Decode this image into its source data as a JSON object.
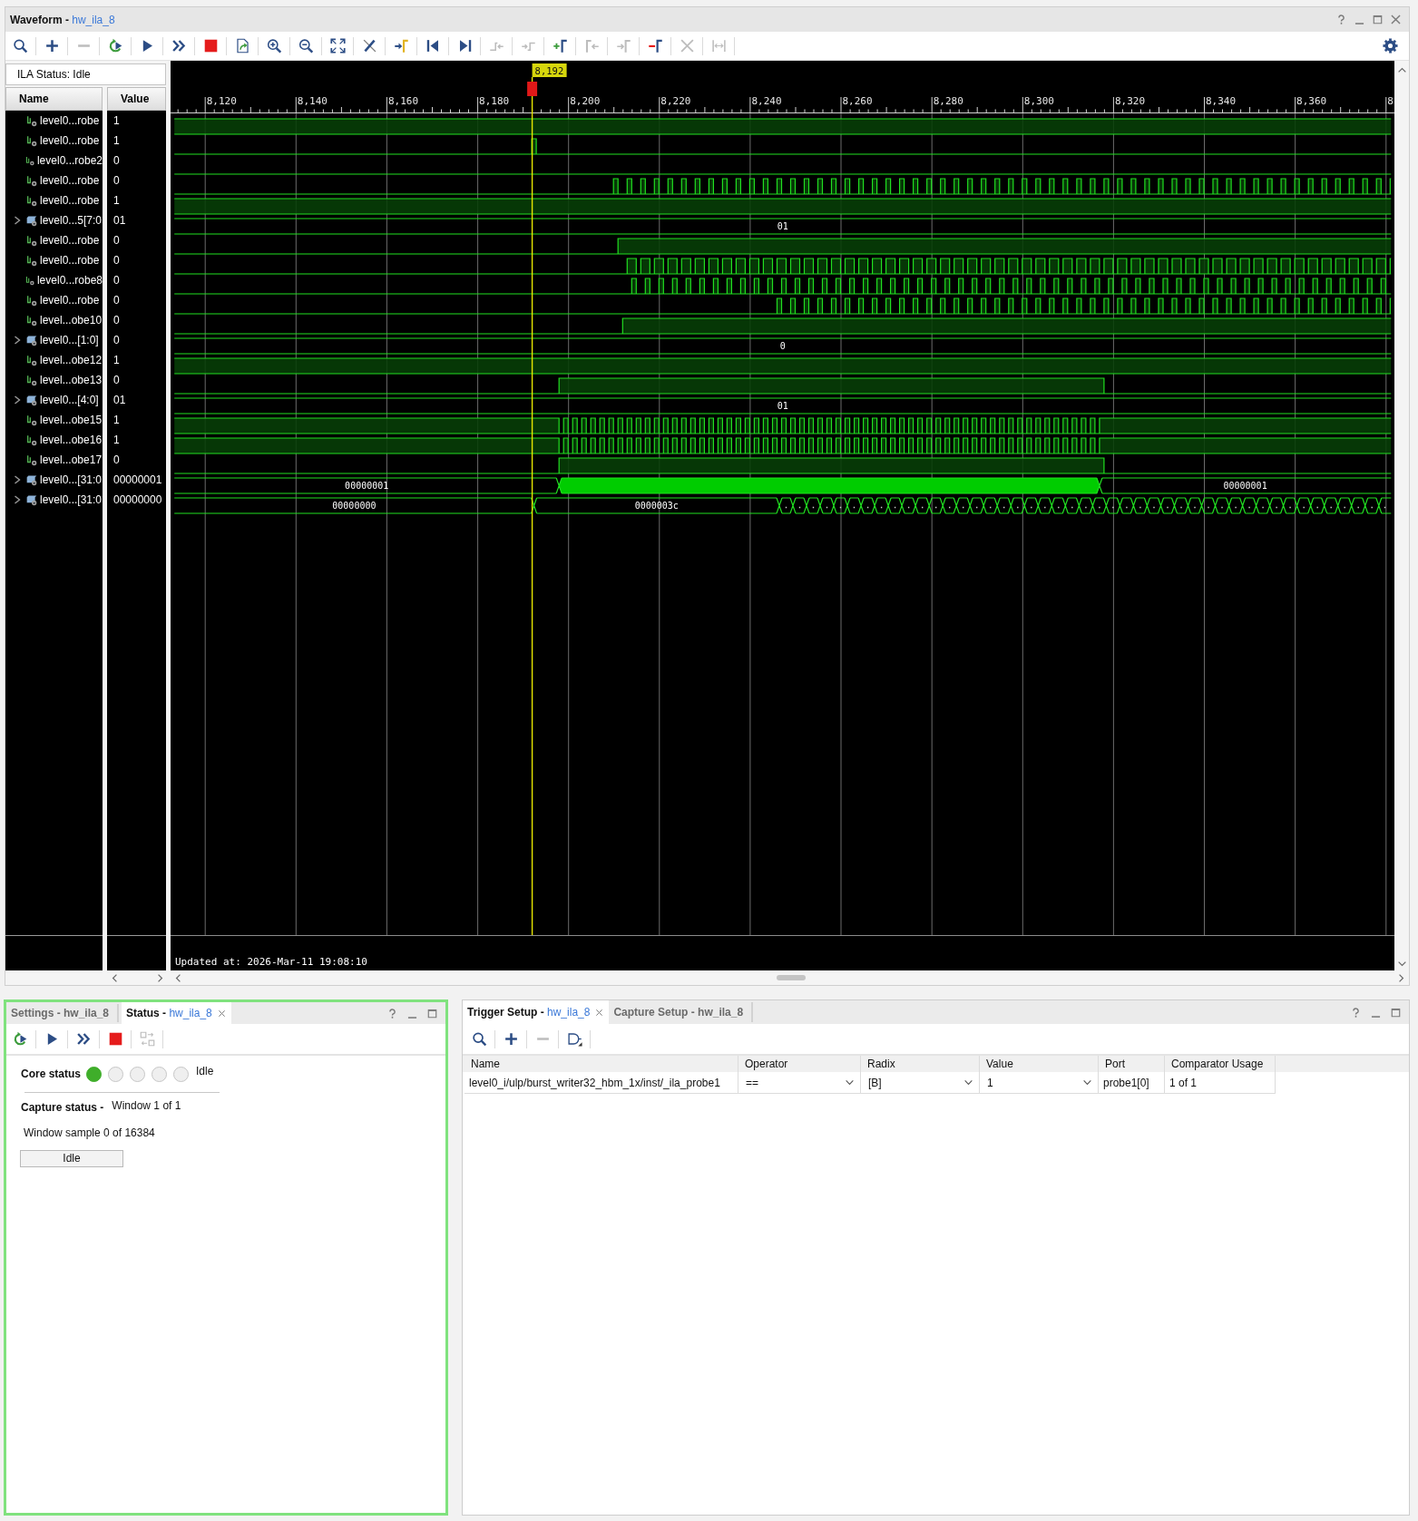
{
  "waveform": {
    "title": "Waveform -",
    "target": "hw_ila_8",
    "toolbar": [
      {
        "kind": "search",
        "disabled": false
      },
      {
        "kind": "add",
        "disabled": false
      },
      {
        "kind": "remove",
        "disabled": true
      },
      {
        "kind": "rerun",
        "disabled": false
      },
      {
        "kind": "run",
        "disabled": false
      },
      {
        "kind": "runall",
        "disabled": false
      },
      {
        "kind": "stop",
        "disabled": false
      },
      {
        "kind": "export",
        "disabled": false
      },
      {
        "kind": "zoomin",
        "disabled": false
      },
      {
        "kind": "zoomout",
        "disabled": false
      },
      {
        "kind": "zoomfit",
        "disabled": false
      },
      {
        "kind": "clear",
        "disabled": false
      },
      {
        "kind": "tocursor",
        "disabled": false
      },
      {
        "kind": "first",
        "disabled": false
      },
      {
        "kind": "last",
        "disabled": false
      },
      {
        "kind": "prevedge",
        "disabled": true
      },
      {
        "kind": "nextedge",
        "disabled": true
      },
      {
        "kind": "addmarker",
        "disabled": false
      },
      {
        "kind": "prevmarker",
        "disabled": true
      },
      {
        "kind": "nextmarker",
        "disabled": true
      },
      {
        "kind": "delmarker",
        "disabled": false
      },
      {
        "kind": "delete",
        "disabled": true
      },
      {
        "kind": "span",
        "disabled": true
      }
    ],
    "ila_status": "ILA Status: Idle",
    "columns": [
      "Name",
      "Value"
    ],
    "ruler": {
      "ticks": [
        "8,120",
        "8,140",
        "8,160",
        "8,180",
        "8,200",
        "8,220",
        "8,240",
        "8,260",
        "8,280",
        "8,300",
        "8,320",
        "8,340",
        "8,360",
        "8"
      ],
      "cursor": "8,192"
    },
    "signals": [
      {
        "kind": "bit",
        "name": "level0...robe",
        "value": "1"
      },
      {
        "kind": "bit",
        "name": "level0...robe",
        "value": "1"
      },
      {
        "kind": "bit",
        "name": "level0...robe2",
        "value": "0"
      },
      {
        "kind": "bit",
        "name": "level0...robe",
        "value": "0"
      },
      {
        "kind": "bit",
        "name": "level0...robe",
        "value": "1"
      },
      {
        "kind": "bus",
        "name": "level0...5[7:0",
        "value": "01",
        "expanded": false,
        "trace_labels": [
          "01"
        ]
      },
      {
        "kind": "bit",
        "name": "level0...robe",
        "value": "0"
      },
      {
        "kind": "bit",
        "name": "level0...robe",
        "value": "0"
      },
      {
        "kind": "bit",
        "name": "level0...robe8",
        "value": "0"
      },
      {
        "kind": "bit",
        "name": "level0...robe",
        "value": "0"
      },
      {
        "kind": "bit",
        "name": "level...obe10",
        "value": "0"
      },
      {
        "kind": "bus",
        "name": "level0...[1:0]",
        "value": "0",
        "expanded": false,
        "trace_labels": [
          "0"
        ]
      },
      {
        "kind": "bit",
        "name": "level...obe12",
        "value": "1"
      },
      {
        "kind": "bit",
        "name": "level...obe13",
        "value": "0"
      },
      {
        "kind": "bus",
        "name": "level0...[4:0]",
        "value": "01",
        "expanded": false,
        "trace_labels": [
          "01"
        ]
      },
      {
        "kind": "bit",
        "name": "level...obe15",
        "value": "1"
      },
      {
        "kind": "bit",
        "name": "level...obe16",
        "value": "1"
      },
      {
        "kind": "bit",
        "name": "level...obe17",
        "value": "0"
      },
      {
        "kind": "bus",
        "name": "level0...[31:0",
        "value": "00000001",
        "expanded": false,
        "trace_labels": [
          "00000001",
          "00000001"
        ]
      },
      {
        "kind": "bus",
        "name": "level0...[31:0",
        "value": "00000000",
        "expanded": false,
        "trace_labels": [
          "00000000",
          "0000003c"
        ]
      }
    ],
    "updated": "Updated at: 2026-Mar-11 19:08:10"
  },
  "status_panel": {
    "tabs": [
      {
        "label": "Settings - hw_ila_8",
        "selected": false
      },
      {
        "label": "Status -",
        "target": "hw_ila_8",
        "selected": true
      }
    ],
    "toolbar": [
      {
        "kind": "rerun",
        "disabled": false
      },
      {
        "kind": "run",
        "disabled": false
      },
      {
        "kind": "runall",
        "disabled": false
      },
      {
        "kind": "stop",
        "disabled": false
      },
      {
        "kind": "swap",
        "disabled": true
      }
    ],
    "core_status": {
      "label": "Core status",
      "indicators": [
        {
          "on": true
        },
        {
          "on": false
        },
        {
          "on": false
        },
        {
          "on": false
        },
        {
          "on": false
        }
      ],
      "value": "Idle"
    },
    "capture_status": {
      "label": "Capture status -",
      "value": "Window 1 of 1"
    },
    "sample": "Window sample 0 of 16384",
    "status_field": "Idle"
  },
  "trigger_panel": {
    "tabs": [
      {
        "label": "Trigger Setup -",
        "target": "hw_ila_8",
        "selected": true
      },
      {
        "label": "Capture Setup - hw_ila_8",
        "selected": false
      }
    ],
    "toolbar": [
      {
        "kind": "search",
        "disabled": false
      },
      {
        "kind": "add",
        "disabled": false
      },
      {
        "kind": "remove",
        "disabled": true
      },
      {
        "kind": "gate",
        "disabled": false
      }
    ],
    "table": {
      "columns": [
        "Name",
        "Operator",
        "Radix",
        "Value",
        "Port",
        "Comparator Usage"
      ],
      "rows": [
        {
          "cells": [
            {
              "kind": "text",
              "text": "level0_i/ulp/burst_writer32_hbm_1x/inst/_ila_probe1"
            },
            {
              "kind": "dropdown",
              "text": "=="
            },
            {
              "kind": "dropdown",
              "text": "[B]"
            },
            {
              "kind": "dropdown",
              "text": "1"
            },
            {
              "kind": "text",
              "text": "probe1[0]"
            },
            {
              "kind": "text",
              "text": "1 of 1"
            }
          ]
        }
      ]
    }
  }
}
